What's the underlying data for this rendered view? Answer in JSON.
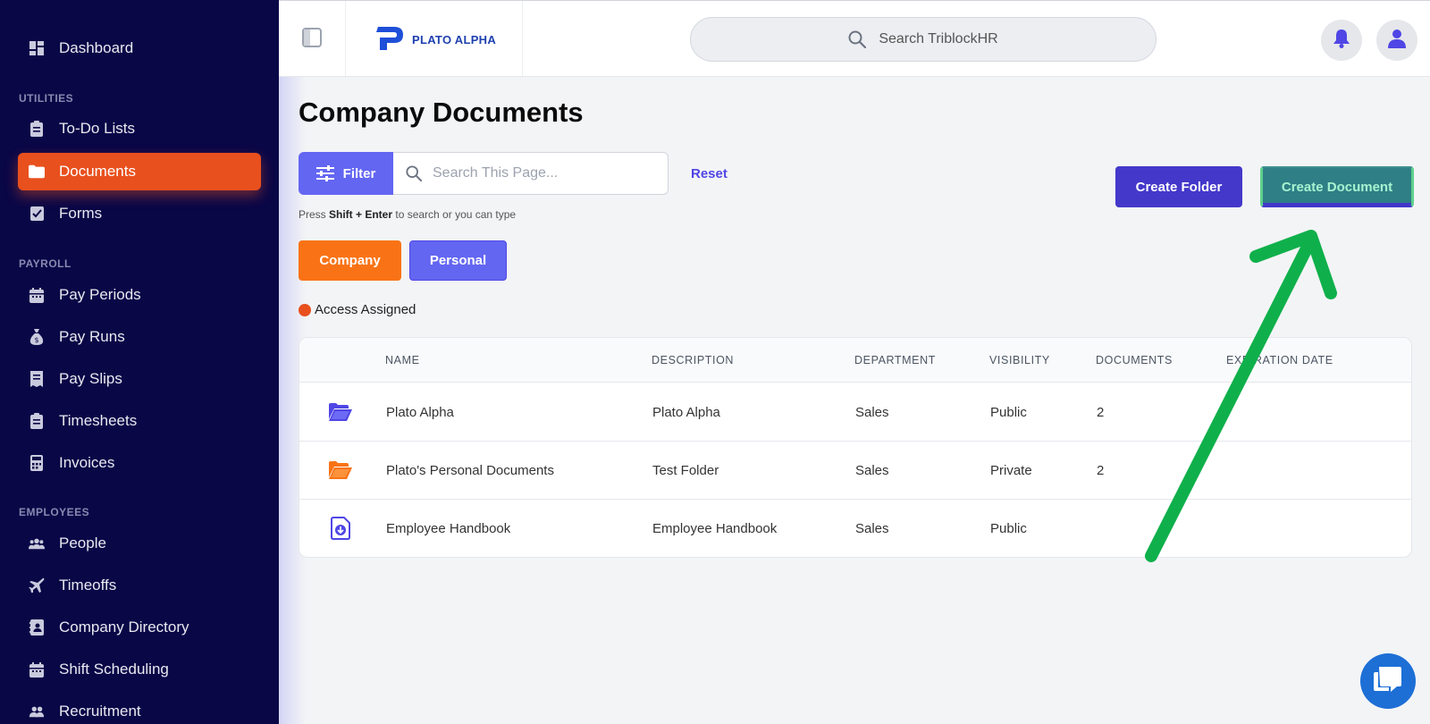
{
  "sidebar": {
    "items": [
      {
        "label": "Dashboard",
        "icon": "dashboard-icon"
      },
      {
        "label": "To-Do Lists",
        "icon": "clipboard-icon"
      },
      {
        "label": "Documents",
        "icon": "folder-icon"
      },
      {
        "label": "Forms",
        "icon": "form-icon"
      },
      {
        "label": "Pay Periods",
        "icon": "calendar-icon"
      },
      {
        "label": "Pay Runs",
        "icon": "money-bag-icon"
      },
      {
        "label": "Pay Slips",
        "icon": "receipt-icon"
      },
      {
        "label": "Timesheets",
        "icon": "clipboard-icon"
      },
      {
        "label": "Invoices",
        "icon": "calculator-icon"
      },
      {
        "label": "People",
        "icon": "people-icon"
      },
      {
        "label": "Timeoffs",
        "icon": "plane-icon"
      },
      {
        "label": "Company Directory",
        "icon": "contact-book-icon"
      },
      {
        "label": "Shift Scheduling",
        "icon": "calendar-icon"
      },
      {
        "label": "Recruitment",
        "icon": "users-icon"
      }
    ],
    "sections": {
      "utilities": "UTILITIES",
      "payroll": "PAYROLL",
      "employees": "EMPLOYEES"
    },
    "active_color": "#e8501e",
    "bg_color": "#0a0747"
  },
  "header": {
    "logo_text": "PLATO ALPHA",
    "search_placeholder": "Search TriblockHR"
  },
  "main": {
    "title": "Company Documents",
    "filter_label": "Filter",
    "search_placeholder": "Search This Page...",
    "reset_label": "Reset",
    "hint": {
      "prefix": "Press ",
      "keys": "Shift + Enter",
      "suffix": " to search or you can type"
    },
    "tabs": [
      {
        "label": "Company",
        "color": "#f97316"
      },
      {
        "label": "Personal",
        "color": "#6366f1"
      }
    ],
    "legend_label": "Access Assigned",
    "create_folder_label": "Create Folder",
    "create_document_label": "Create Document"
  },
  "table": {
    "columns": [
      "NAME",
      "DESCRIPTION",
      "DEPARTMENT",
      "VISIBILITY",
      "DOCUMENTS",
      "EXPIRATION DATE"
    ],
    "rows": [
      {
        "icon": "folder-open-icon",
        "icon_color": "#4f46e5",
        "name": "Plato Alpha",
        "description": "Plato Alpha",
        "department": "Sales",
        "visibility": "Public",
        "documents": "2",
        "expiration": ""
      },
      {
        "icon": "folder-open-icon",
        "icon_color": "#f97316",
        "name": "Plato's Personal Documents",
        "description": "Test Folder",
        "department": "Sales",
        "visibility": "Private",
        "documents": "2",
        "expiration": ""
      },
      {
        "icon": "file-download-icon",
        "icon_color": "#4f46e5",
        "name": "Employee Handbook",
        "description": "Employee Handbook",
        "department": "Sales",
        "visibility": "Public",
        "documents": "",
        "expiration": ""
      }
    ]
  }
}
